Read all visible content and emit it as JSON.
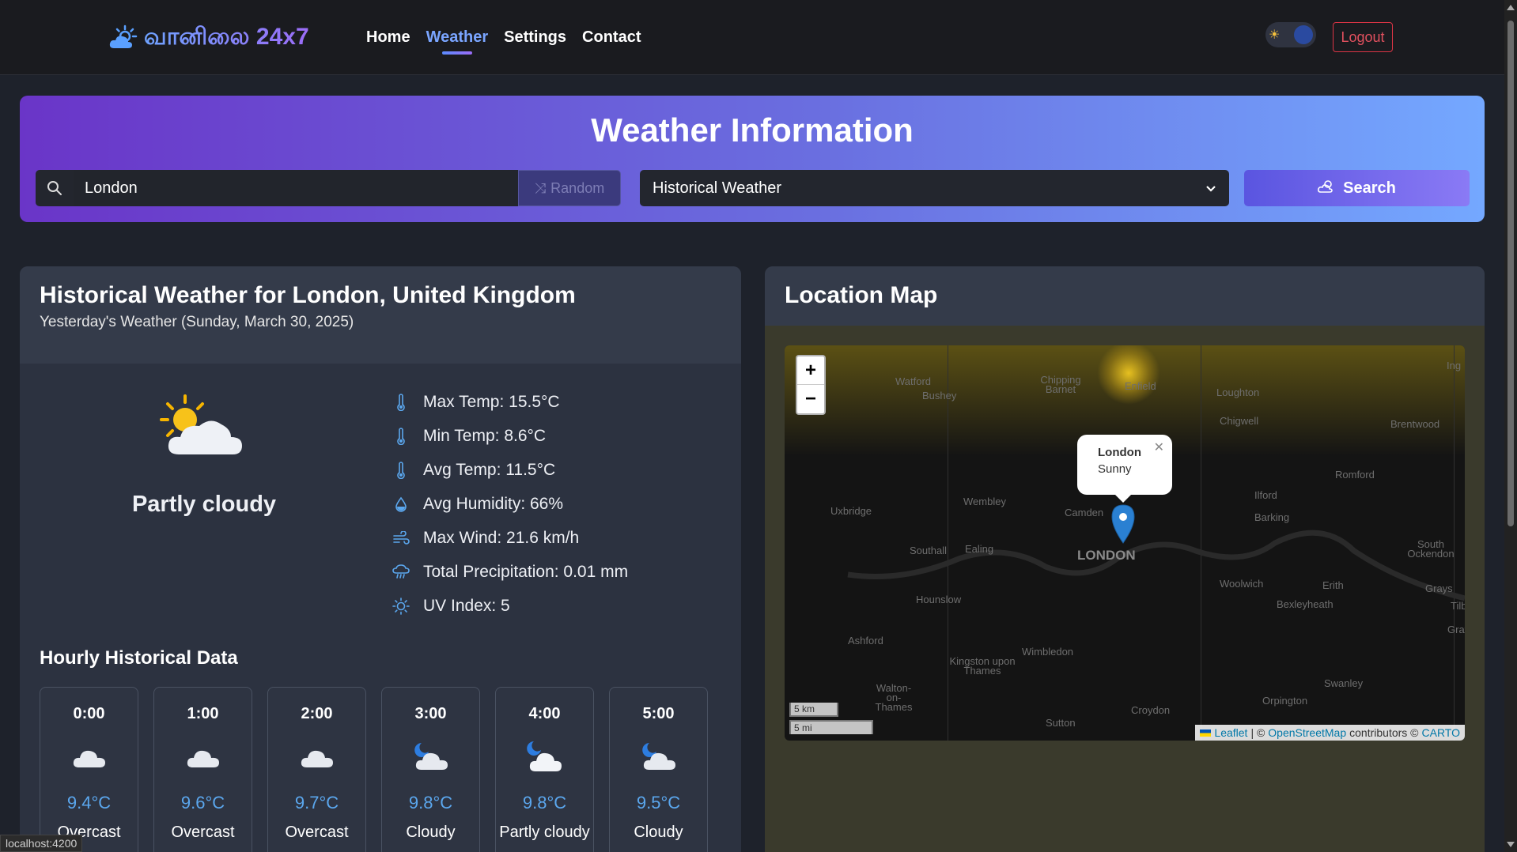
{
  "brand": {
    "name": "வானிலை 24x7",
    "icon": "sun-cloud-icon"
  },
  "nav": {
    "items": [
      {
        "label": "Home",
        "active": false
      },
      {
        "label": "Weather",
        "active": true
      },
      {
        "label": "Settings",
        "active": false
      },
      {
        "label": "Contact",
        "active": false
      }
    ],
    "logout_label": "Logout",
    "theme_toggle": {
      "icon": "sun-icon",
      "mode": "dark"
    }
  },
  "hero": {
    "title": "Weather Information",
    "search": {
      "value": "London",
      "icon": "search-icon"
    },
    "random_label": "Random",
    "type_select": {
      "selected": "Historical Weather"
    },
    "search_label": "Search"
  },
  "historical": {
    "title": "Historical Weather for London, United Kingdom",
    "subtitle": "Yesterday's Weather (Sunday, March 30, 2025)",
    "condition": "Partly cloudy",
    "stats": [
      {
        "icon": "thermometer-icon",
        "text": "Max Temp: 15.5°C"
      },
      {
        "icon": "thermometer-icon",
        "text": "Min Temp: 8.6°C"
      },
      {
        "icon": "thermometer-icon",
        "text": "Avg Temp: 11.5°C"
      },
      {
        "icon": "droplet-icon",
        "text": "Avg Humidity: 66%"
      },
      {
        "icon": "wind-icon",
        "text": "Max Wind: 21.6 km/h"
      },
      {
        "icon": "rain-cloud-icon",
        "text": "Total Precipitation: 0.01 mm"
      },
      {
        "icon": "sun-icon",
        "text": "UV Index: 5"
      }
    ],
    "hourly_title": "Hourly Historical Data",
    "hourly": [
      {
        "time": "0:00",
        "temp": "9.4°C",
        "condition": "Overcast",
        "icon": "cloud-icon"
      },
      {
        "time": "1:00",
        "temp": "9.6°C",
        "condition": "Overcast",
        "icon": "cloud-icon"
      },
      {
        "time": "2:00",
        "temp": "9.7°C",
        "condition": "Overcast",
        "icon": "cloud-icon"
      },
      {
        "time": "3:00",
        "temp": "9.8°C",
        "condition": "Cloudy",
        "icon": "moon-cloud-icon"
      },
      {
        "time": "4:00",
        "temp": "9.8°C",
        "condition": "Partly cloudy",
        "icon": "moon-cloud-icon"
      },
      {
        "time": "5:00",
        "temp": "9.5°C",
        "condition": "Cloudy",
        "icon": "moon-cloud-icon"
      }
    ]
  },
  "map": {
    "title": "Location Map",
    "popup": {
      "title": "London",
      "body": "Sunny"
    },
    "zoom_in": "+",
    "zoom_out": "−",
    "scale_km": "5 km",
    "scale_mi": "5 mi",
    "attribution": {
      "leaflet": "Leaflet",
      "sep": "| ©",
      "osm": "OpenStreetMap",
      "contrib": "contributors ©",
      "carto": "CARTO"
    },
    "places": [
      "Watford",
      "Bushey",
      "Chipping Barnet",
      "Enfield",
      "Loughton",
      "Chigwell",
      "Brentwood",
      "Ing",
      "Romford",
      "Uxbridge",
      "Wembley",
      "Camden",
      "Ilford",
      "Barking",
      "South Ockendon",
      "Southall",
      "Ealing",
      "LONDON",
      "Hounslow",
      "Woolwich",
      "Erith",
      "Grays",
      "Tilb",
      "Bexleyheath",
      "Grav",
      "Ashford",
      "Wimbledon",
      "Kingston upon Thames",
      "Walton-on-Thames",
      "Swanley",
      "Orpington",
      "Croydon",
      "Sutton"
    ]
  },
  "status_url": "localhost:4200"
}
